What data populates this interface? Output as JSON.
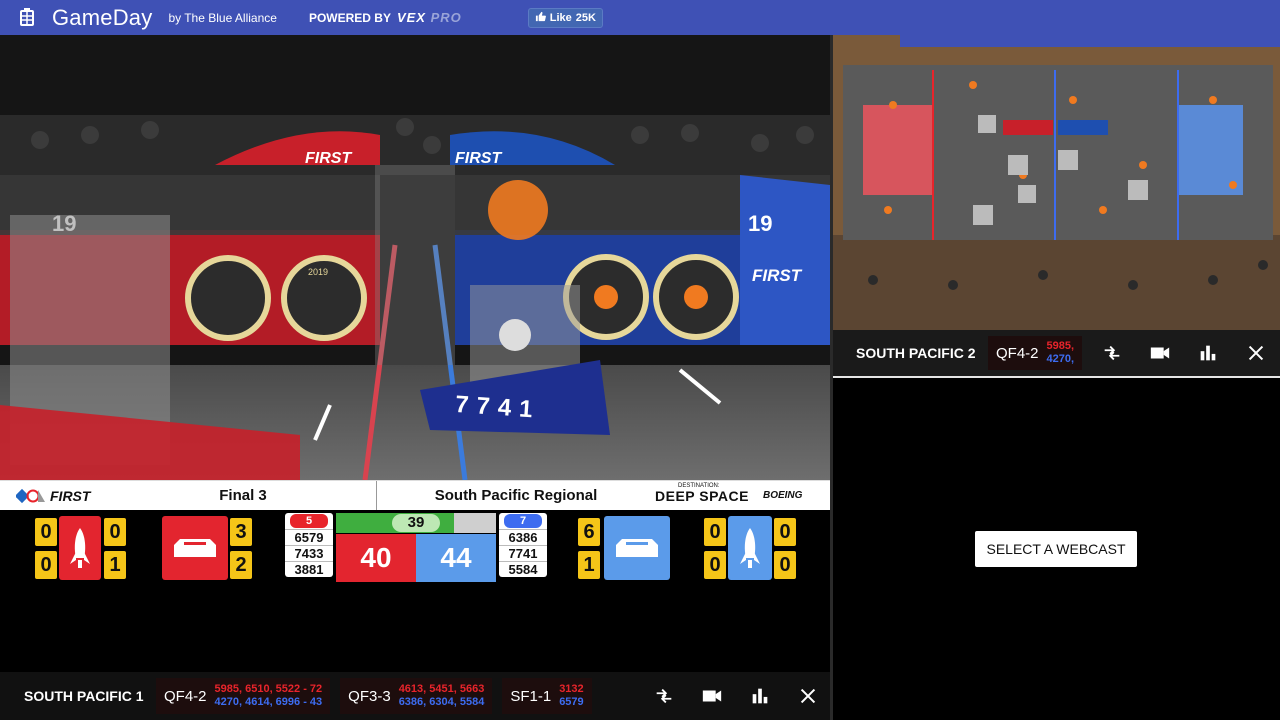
{
  "navbar": {
    "title": "GameDay",
    "by": "by The Blue Alliance",
    "powered_by": "POWERED BY",
    "sponsor_vex": "VEX",
    "sponsor_pro": "PRO",
    "like_label": "Like",
    "like_count": "25K",
    "color": "#3f51b5"
  },
  "main_overlay": {
    "program": "FIRST",
    "match": "Final 3",
    "event": "South Pacific Regional",
    "game_destination": "DESTINATION:",
    "game_title": "DEEP SPACE",
    "sponsor": "BOEING",
    "timer": "39",
    "timer_progress_fraction": 0.74,
    "red": {
      "rank": "5",
      "teams": [
        "6579",
        "7433",
        "3881"
      ],
      "score": "40",
      "habitat": [
        "0",
        "0"
      ],
      "habitat_right": [
        "0",
        "1"
      ],
      "cargo": [
        "3",
        "2"
      ],
      "color": "#e8242b"
    },
    "blue": {
      "rank": "7",
      "teams": [
        "6386",
        "7741",
        "5584"
      ],
      "score": "44",
      "cargo": [
        "6",
        "1"
      ],
      "habitat": [
        "0",
        "0"
      ],
      "habitat_right": [
        "0",
        "0"
      ],
      "color": "#5b9bea"
    }
  },
  "webcast_left": {
    "name": "SOUTH PACIFIC 1",
    "matches": [
      {
        "label": "QF4-2",
        "red": "5985, 6510, 5522 - 72",
        "blue": "4270, 4614, 6996 - 43"
      },
      {
        "label": "QF3-3",
        "red": "4613, 5451, 5663",
        "blue": "6386, 6304, 5584"
      },
      {
        "label": "SF1-1",
        "red": "3132",
        "blue": "6579"
      }
    ],
    "icons": [
      "swap-icon",
      "camera-icon",
      "chart-icon",
      "close-icon"
    ]
  },
  "webcast_right": {
    "name": "SOUTH PACIFIC 2",
    "match": {
      "label": "QF4-2",
      "red": "5985,",
      "blue": "4270,"
    },
    "icons": [
      "swap-icon",
      "camera-icon",
      "chart-icon",
      "close-icon"
    ]
  },
  "empty_slot": {
    "button_label": "SELECT A WEBCAST"
  },
  "video_main": {
    "robot_number": "7741",
    "field_marker": "19",
    "field_brand": "FIRST",
    "field_year": "2019"
  }
}
